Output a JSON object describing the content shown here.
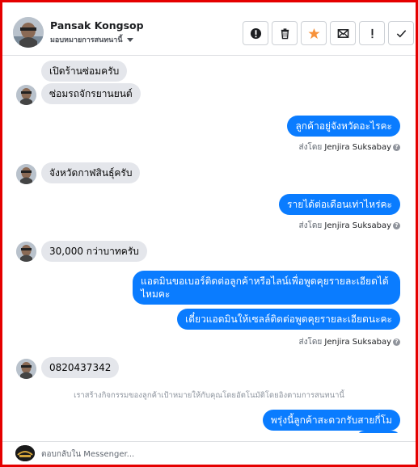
{
  "header": {
    "contact_name": "Pansak Kongsop",
    "assign_label": "มอบหมายการสนทนานี้",
    "tools": [
      {
        "name": "report-spam-icon",
        "label": "!"
      },
      {
        "name": "trash-icon",
        "label": ""
      },
      {
        "name": "star-icon",
        "label": ""
      },
      {
        "name": "mark-unread-icon",
        "label": ""
      },
      {
        "name": "exclamation-icon",
        "label": "!"
      },
      {
        "name": "check-icon",
        "label": ""
      }
    ]
  },
  "colors": {
    "outgoing_bubble": "#0a7cff",
    "incoming_bubble": "#e4e6eb",
    "star": "#f7923b",
    "frame_border": "#e50000"
  },
  "messages": {
    "in_1": "เปิดร้านซ่อมครับ",
    "in_2": "ซ่อมรถจักรยานยนต์",
    "out_1": "ลูกค้าอยู่จังหวัดอะไรคะ",
    "sent_by_prefix": "ส่งโดย",
    "agent_name": "Jenjira Suksabay",
    "in_3": "จังหวัดกาฬสินธุ์ครับ",
    "out_2": "รายได้ต่อเดือนเท่าไหร่คะ",
    "in_4": "30,000 กว่าบาทครับ",
    "out_3": "แอดมินขอเบอร์ติดต่อลูกค้าหรือไลน์เพื่อพูดคุยรายละเอียดได้ไหมคะ",
    "out_4": "เดี๋ยวแอดมินให้เซลล์ติดต่อพูดคุยรายละเอียดนะคะ",
    "in_5": "0820437342",
    "system_note": "เราสร้างกิจกรรมของลูกค้าเป้าหมายให้กับคุณโดยอัตโนมัติโดยอิงตามการสนทนานี้",
    "out_5": "พรุ่งนี้ลูกค้าสะดวกรับสายกี่โม"
  },
  "composer": {
    "placeholder": "ตอบกลับใน Messenger..."
  }
}
